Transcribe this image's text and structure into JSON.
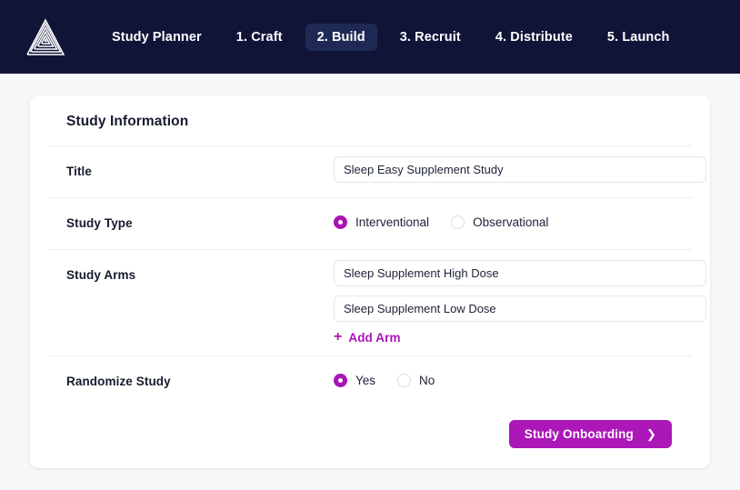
{
  "colors": {
    "nav_background": "#101538",
    "nav_active_tab": "#1e2a54",
    "accent_purple": "#a914b5",
    "button_purple": "#ac17b8",
    "page_background": "#f6f7f9",
    "card_background": "#ffffff",
    "divider": "#edeef1",
    "text_dark": "#161b2e"
  },
  "nav": {
    "logo_icon": "spiral-triangle-logo",
    "items": [
      {
        "label": "Study Planner",
        "active": false
      },
      {
        "label": "1. Craft",
        "active": false
      },
      {
        "label": "2. Build",
        "active": true
      },
      {
        "label": "3. Recruit",
        "active": false
      },
      {
        "label": "4. Distribute",
        "active": false
      },
      {
        "label": "5. Launch",
        "active": false
      }
    ]
  },
  "card": {
    "title": "Study Information",
    "rows": {
      "title": {
        "label": "Title",
        "value": "Sleep Easy Supplement Study",
        "placeholder": "Title"
      },
      "study_type": {
        "label": "Study Type",
        "options": [
          {
            "label": "Interventional",
            "checked": true
          },
          {
            "label": "Observational",
            "checked": false
          }
        ]
      },
      "study_arms": {
        "label": "Study Arms",
        "arms": [
          {
            "value": "Sleep Supplement High Dose",
            "placeholder": "Arm name"
          },
          {
            "value": "Sleep Supplement Low Dose",
            "placeholder": "Arm name"
          }
        ],
        "add_arm_label": "Add Arm",
        "add_arm_icon": "plus-icon"
      },
      "randomize": {
        "label": "Randomize Study",
        "options": [
          {
            "label": "Yes",
            "checked": true
          },
          {
            "label": "No",
            "checked": false
          }
        ]
      }
    },
    "footer": {
      "submit_label": "Study Onboarding",
      "submit_icon": "chevron-right-icon"
    }
  }
}
